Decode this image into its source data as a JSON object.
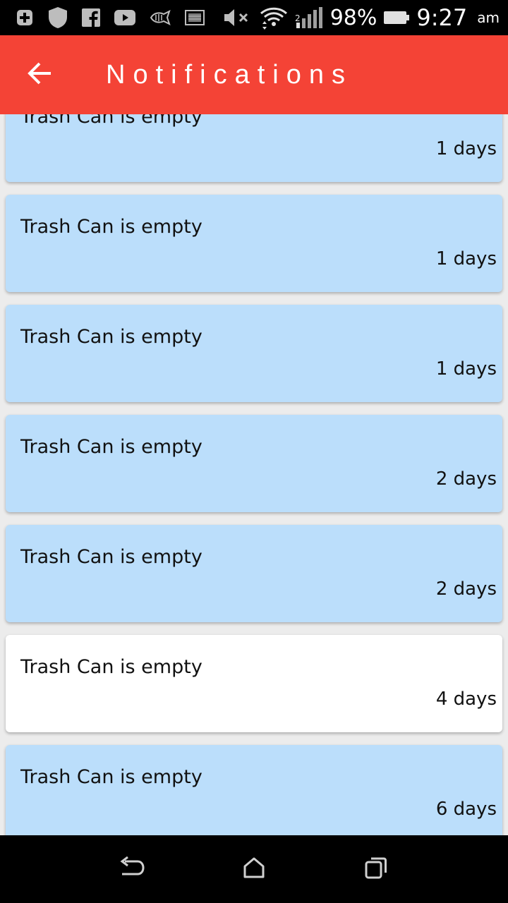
{
  "status_bar": {
    "battery_percent": "98%",
    "time": "9:27",
    "ampm": "am",
    "icons": [
      "add-box-icon",
      "shield-icon",
      "facebook-icon",
      "youtube-icon",
      "fish-icon",
      "photo-icon",
      "volume-mute-icon",
      "wifi-icon",
      "signal-icon",
      "battery-icon"
    ]
  },
  "app_bar": {
    "title": "Notifications",
    "back_icon": "arrow-back-icon",
    "color": "#f44336"
  },
  "notifications": [
    {
      "title": "Trash Can is empty",
      "time": "1 days",
      "read": false
    },
    {
      "title": "Trash Can is empty",
      "time": "1 days",
      "read": false
    },
    {
      "title": "Trash Can is empty",
      "time": "1 days",
      "read": false
    },
    {
      "title": "Trash Can is empty",
      "time": "2 days",
      "read": false
    },
    {
      "title": "Trash Can is empty",
      "time": "2 days",
      "read": false
    },
    {
      "title": "Trash Can is empty",
      "time": "4 days",
      "read": true
    },
    {
      "title": "Trash Can is empty",
      "time": "6 days",
      "read": false
    }
  ],
  "colors": {
    "unread_card": "#bbdefb",
    "read_card": "#ffffff",
    "background": "#ececec"
  },
  "nav_bar": {
    "buttons": [
      "back-nav-icon",
      "home-nav-icon",
      "recents-nav-icon"
    ]
  }
}
